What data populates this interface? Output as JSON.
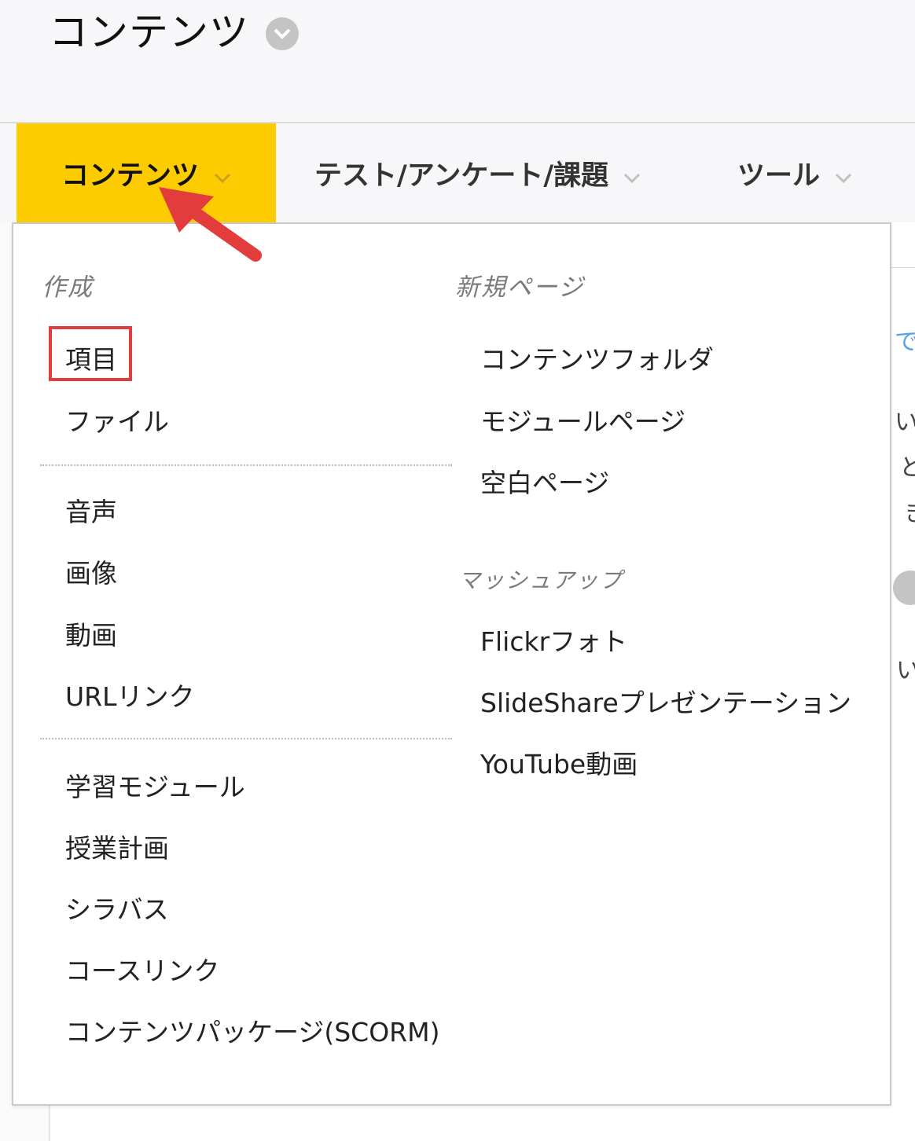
{
  "header": {
    "title": "コンテンツ"
  },
  "toolbar": {
    "tabs": [
      {
        "label": "コンテンツ",
        "active": true
      },
      {
        "label": "テスト/アンケート/課題"
      },
      {
        "label": "ツール"
      }
    ]
  },
  "dropdown": {
    "create_heading": "作成",
    "create_group1": [
      "項目",
      "ファイル"
    ],
    "create_group2": [
      "音声",
      "画像",
      "動画",
      "URLリンク"
    ],
    "create_group3": [
      "学習モジュール",
      "授業計画",
      "シラバス",
      "コースリンク",
      "コンテンツパッケージ(SCORM)"
    ],
    "newpage_heading": "新規ページ",
    "newpage_items": [
      "コンテンツフォルダ",
      "モジュールページ",
      "空白ページ"
    ],
    "mashup_heading": "マッシュアップ",
    "mashup_items": [
      "Flickrフォト",
      "SlideShareプレゼンテーション",
      "YouTube動画"
    ]
  },
  "background_peek": [
    "で",
    "い",
    "と",
    "き",
    "い"
  ],
  "colors": {
    "active_tab": "#fccc00",
    "annotation_red": "#e23c3c",
    "highlight_box": "#e23c3c"
  },
  "annotations": {
    "highlighted_item": "項目",
    "arrow_target": "コンテンツ"
  }
}
